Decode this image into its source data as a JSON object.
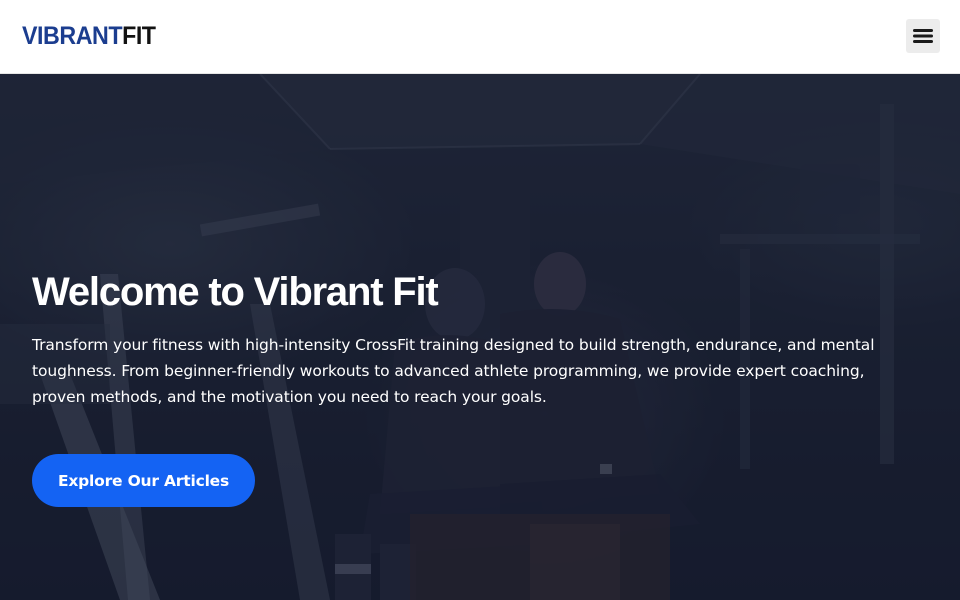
{
  "header": {
    "logo": {
      "part1": "VIBRANT",
      "part2": "FIT"
    },
    "menu_icon": "hamburger-menu-icon"
  },
  "hero": {
    "title": "Welcome to Vibrant Fit",
    "description": "Transform your fitness with high-intensity CrossFit training designed to build strength, endurance, and mental toughness. From beginner-friendly workouts to advanced athlete programming, we provide expert coaching, proven methods, and the motivation you need to reach your goals.",
    "cta_label": "Explore Our Articles",
    "background_image": "gym-athletes-photo"
  },
  "colors": {
    "logo_primary": "#1b3d8f",
    "logo_secondary": "#121212",
    "cta_background": "#1463f3",
    "hero_overlay": "#12182c"
  }
}
